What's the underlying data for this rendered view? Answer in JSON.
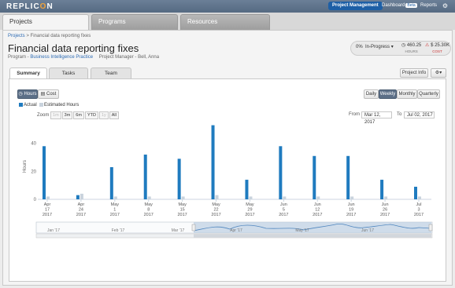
{
  "app": {
    "brand_a": "REPLIC",
    "brand_o": "O",
    "brand_b": "N"
  },
  "topnav": {
    "project_management": "Project Management",
    "dashboard": "Dashboard",
    "beta": "Beta",
    "reports": "Reports",
    "settings_icon": "gear-icon"
  },
  "main_tabs": [
    {
      "label": "Projects"
    },
    {
      "label": "Programs"
    },
    {
      "label": "Resources"
    }
  ],
  "breadcrumb": {
    "root": "Projects",
    "sep": " > ",
    "current": "Financial data reporting fixes"
  },
  "project": {
    "title": "Financial data reporting fixes",
    "program_prefix": "Program - ",
    "program": "Business Intelligence Practice",
    "manager": "Project Manager - Bell, Anna"
  },
  "status": {
    "percent": "0%",
    "state": "In-Progress",
    "hours_value": "460.25",
    "hours_label": "HOURS",
    "cost_value": "$ 25.30K",
    "cost_label": "COST",
    "hours_color": "#555555",
    "cost_color": "#cc3333"
  },
  "subtabs": [
    {
      "label": "Summary"
    },
    {
      "label": "Tasks"
    },
    {
      "label": "Team"
    }
  ],
  "toolbar": {
    "project_info": "Project Info",
    "settings_icon": "gear-icon"
  },
  "metric_toggle": {
    "hours": "Hours",
    "cost": "Cost"
  },
  "period_toggle": [
    {
      "label": "Daily"
    },
    {
      "label": "Weekly"
    },
    {
      "label": "Monthly"
    },
    {
      "label": "Quarterly"
    }
  ],
  "legend": {
    "actual": "Actual",
    "estimated": "Estimated Hours"
  },
  "zoom": {
    "label": "Zoom",
    "buttons": [
      "1m",
      "3m",
      "6m",
      "YTD",
      "1y",
      "All"
    ]
  },
  "range": {
    "from_label": "From",
    "from": "Mar 12, 2017",
    "to_label": "To",
    "to": "Jul 02, 2017"
  },
  "chart_data": {
    "type": "bar",
    "ylabel": "Hours",
    "ylim": [
      0,
      55
    ],
    "yticks": [
      0,
      20,
      40
    ],
    "categories": [
      "Apr 17 2017",
      "Apr 24 2017",
      "May 1 2017",
      "May 8 2017",
      "May 15 2017",
      "May 22 2017",
      "May 29 2017",
      "Jun 5 2017",
      "Jun 12 2017",
      "Jun 19 2017",
      "Jun 26 2017",
      "Jul 3 2017"
    ],
    "category_parts": [
      [
        "Apr",
        "17",
        "2017"
      ],
      [
        "Apr",
        "24",
        "2017"
      ],
      [
        "May",
        "1",
        "2017"
      ],
      [
        "May",
        "8",
        "2017"
      ],
      [
        "May",
        "15",
        "2017"
      ],
      [
        "May",
        "22",
        "2017"
      ],
      [
        "May",
        "29",
        "2017"
      ],
      [
        "Jun",
        "5",
        "2017"
      ],
      [
        "Jun",
        "12",
        "2017"
      ],
      [
        "Jun",
        "19",
        "2017"
      ],
      [
        "Jun",
        "26",
        "2017"
      ],
      [
        "Jul",
        "3",
        "2017"
      ]
    ],
    "series": [
      {
        "name": "Actual",
        "color": "#1f7bbf",
        "values": [
          38,
          3,
          23,
          32,
          29,
          53,
          14,
          38,
          31,
          31,
          14,
          9
        ]
      },
      {
        "name": "Estimated Hours",
        "color": "#c9d3dd",
        "values": [
          2,
          4,
          2,
          2,
          2,
          3,
          2,
          2,
          2,
          2,
          2,
          2
        ]
      }
    ],
    "navigator_labels": [
      "Jan '17",
      "Feb '17",
      "Mar '17",
      "Apr '17",
      "May '17",
      "Jun '17"
    ],
    "grid": false,
    "legend_position": "top-left"
  }
}
